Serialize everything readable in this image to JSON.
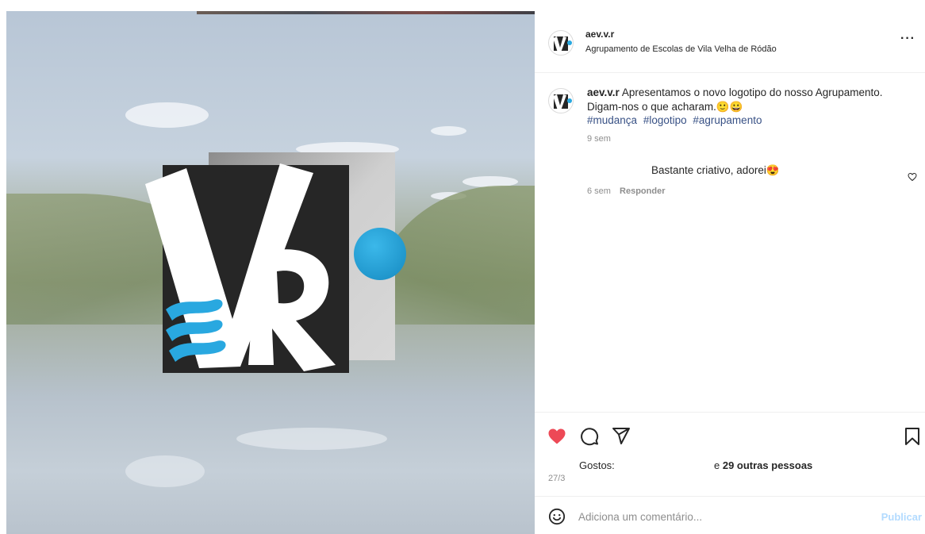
{
  "post": {
    "username": "aev.v.r",
    "location": "Agrupamento de Escolas de Vila Velha de Ródão",
    "more_icon": "ellipsis-icon",
    "caption": {
      "username": "aev.v.r",
      "text": "Apresentamos o novo logotipo do nosso Agrupamento. Digam-nos o que acharam.🙂😀",
      "hashtags": [
        "#mudança",
        "#logotipo",
        "#agrupamento"
      ],
      "time": "9 sem"
    },
    "comments": [
      {
        "text": "Bastante criativo, adorei😍",
        "time": "6 sem",
        "reply_label": "Responder"
      }
    ],
    "likes": {
      "label": "Gostos:",
      "others_prefix": "e ",
      "others_count": "29 outras pessoas"
    },
    "date": "27/3",
    "comment_input": {
      "placeholder": "Adiciona um comentário...",
      "publish_label": "Publicar"
    }
  },
  "colors": {
    "heart": "#ed4956",
    "hashtag": "#385185",
    "publish": "#b3dbff",
    "logo_blue": "#29a8e0"
  },
  "icons": [
    "heart-icon",
    "comment-icon",
    "share-icon",
    "bookmark-icon",
    "emoji-icon",
    "like-comment-icon"
  ]
}
